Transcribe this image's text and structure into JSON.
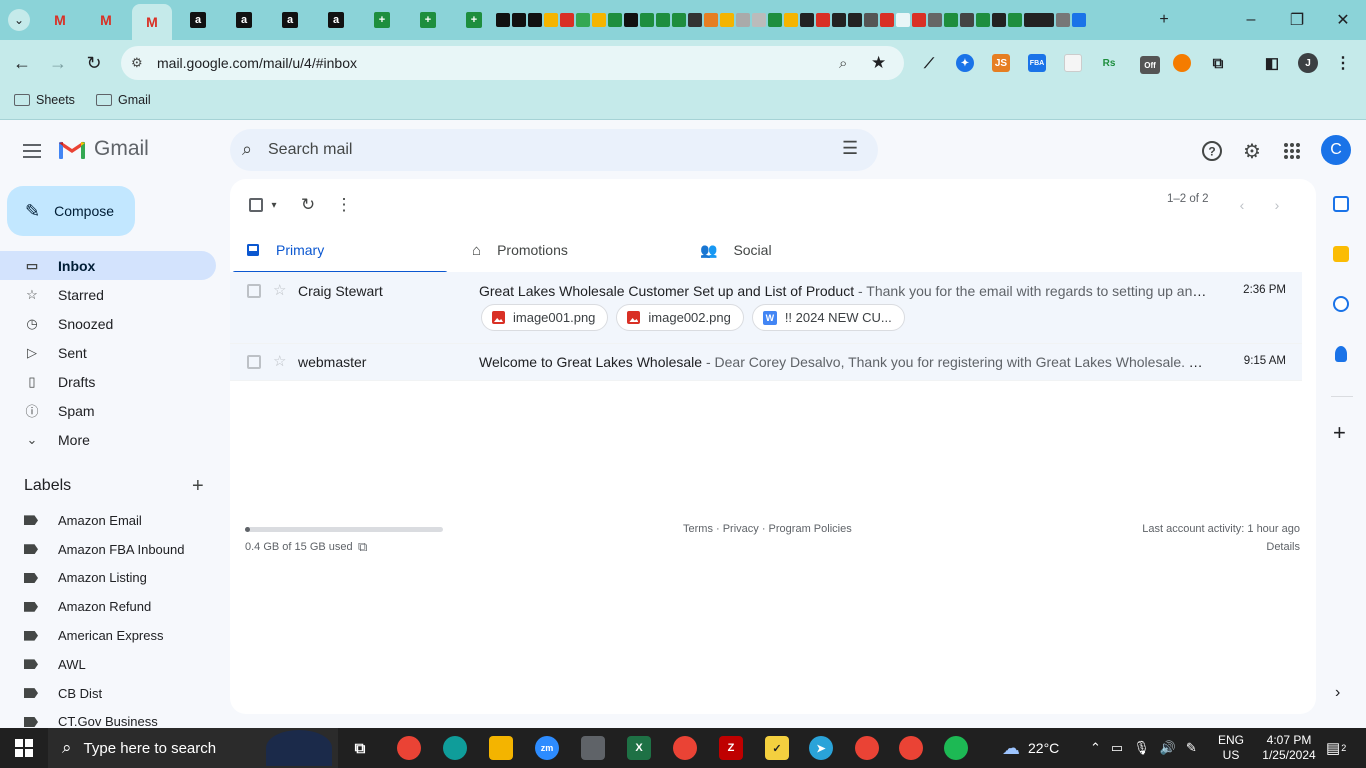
{
  "browser": {
    "url": "mail.google.com/mail/u/4/#inbox",
    "bookmarks": [
      "Sheets",
      "Gmail"
    ],
    "tabs": [
      {
        "icon": "gmail-icon",
        "color": "#d93025"
      },
      {
        "icon": "gmail-icon",
        "color": "#d93025"
      },
      {
        "icon": "gmail-icon",
        "color": "#d93025",
        "active": true
      },
      {
        "icon": "amazon-icon",
        "label": "a"
      },
      {
        "icon": "amazon-icon",
        "label": "a"
      },
      {
        "icon": "amazon-icon",
        "label": "a"
      },
      {
        "icon": "amazon-icon",
        "label": "a"
      },
      {
        "icon": "sheets-icon",
        "label": "+"
      },
      {
        "icon": "sheets-icon",
        "label": "+"
      },
      {
        "icon": "sheets-icon",
        "label": "+"
      }
    ],
    "extensions": [
      {
        "label": "JS",
        "color": "#e67e22"
      },
      {
        "label": "FBA",
        "color": "#1a73e8"
      },
      {
        "label": "Rs",
        "color": "#1e8e3e"
      },
      {
        "label": "Off",
        "color": "#555555"
      }
    ],
    "profile_initial": "J"
  },
  "gmail": {
    "brand": "Gmail",
    "search_placeholder": "Search mail",
    "avatar_initial": "C",
    "compose_label": "Compose",
    "nav": [
      {
        "label": "Inbox",
        "icon": "inbox-icon",
        "glyph": "▭"
      },
      {
        "label": "Starred",
        "icon": "star-icon",
        "glyph": "☆"
      },
      {
        "label": "Snoozed",
        "icon": "clock-icon",
        "glyph": "◷"
      },
      {
        "label": "Sent",
        "icon": "send-icon",
        "glyph": "▷"
      },
      {
        "label": "Drafts",
        "icon": "draft-icon",
        "glyph": "▯"
      },
      {
        "label": "Spam",
        "icon": "spam-icon",
        "glyph": "ⓘ"
      },
      {
        "label": "More",
        "icon": "chevron-down-icon",
        "glyph": "⌄"
      }
    ],
    "labels_heading": "Labels",
    "labels": [
      "Amazon Email",
      "Amazon FBA Inbound",
      "Amazon Listing",
      "Amazon Refund",
      "American Express",
      "AWL",
      "CB Dist",
      "CT.Gov Business"
    ],
    "pager_text": "1–2 of 2",
    "category_tabs": [
      {
        "label": "Primary",
        "icon": "inbox-icon",
        "active": true
      },
      {
        "label": "Promotions",
        "icon": "tag-icon"
      },
      {
        "label": "Social",
        "icon": "people-icon"
      }
    ],
    "emails": [
      {
        "sender": "Craig Stewart",
        "subject": "Great Lakes Wholesale Customer Set up and List of Product",
        "snippet": " - Thank you for the email with regards to setting up an account ...",
        "time": "2:36 PM",
        "attachments": [
          {
            "name": "image001.png",
            "type": "image"
          },
          {
            "name": "image002.png",
            "type": "image"
          },
          {
            "name": "!! 2024 NEW CU...",
            "type": "word"
          }
        ]
      },
      {
        "sender": "webmaster",
        "subject": "Welcome to Great Lakes Wholesale",
        "snippet": " - Dear Corey Desalvo, Thank you for registering with Great Lakes Wholesale. To enable yo...",
        "time": "9:15 AM"
      }
    ],
    "storage_text": "0.4 GB of 15 GB used",
    "storage_fraction": 0.027,
    "footer_links": "Terms · Privacy · Program Policies",
    "last_activity": "Last account activity: 1 hour ago",
    "details_link": "Details"
  },
  "taskbar": {
    "search_placeholder": "Type here to search",
    "weather": "22°C",
    "language": "ENG",
    "region": "US",
    "time": "4:07 PM",
    "date": "1/25/2024",
    "notifications": "2"
  }
}
